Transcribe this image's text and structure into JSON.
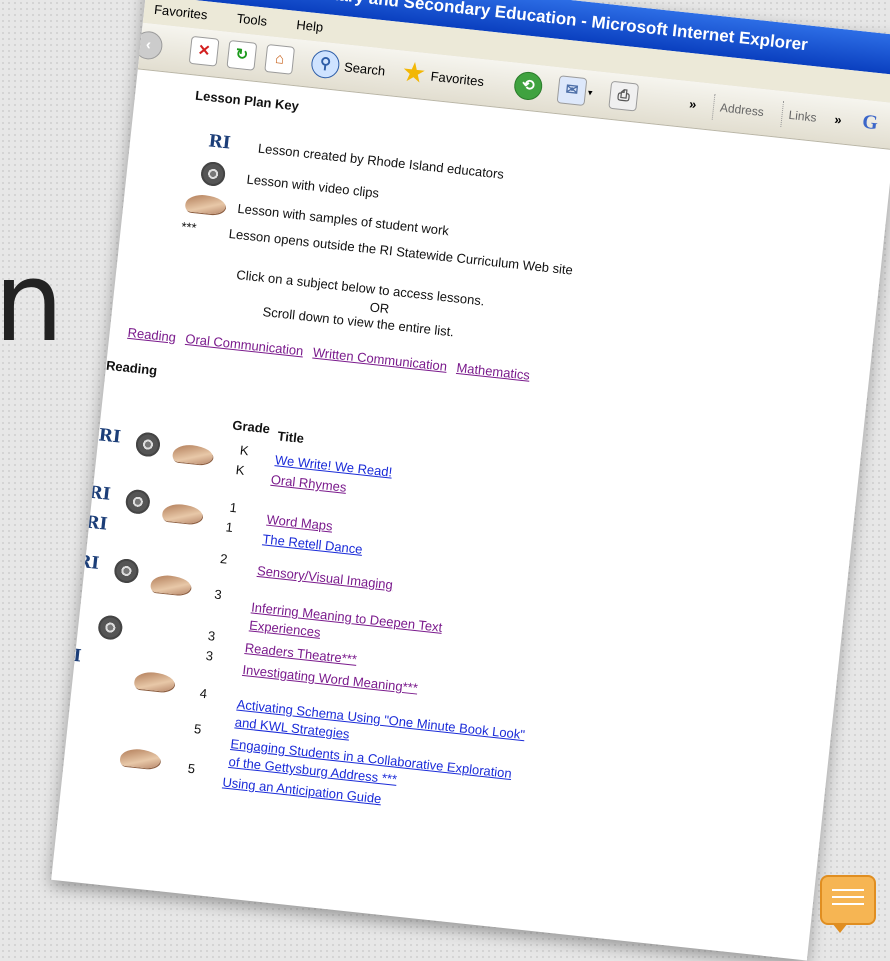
{
  "window": {
    "title": "Department of Elementary and Secondary Education - Microsoft Internet Explorer"
  },
  "menu": [
    "Favorites",
    "Tools",
    "Help"
  ],
  "toolbar": {
    "search_label": "Search",
    "favorites_label": "Favorites",
    "chevron": "»",
    "address_label": "Address",
    "links_label": "Links",
    "links_chevron": "»",
    "trailing_label": "G"
  },
  "key": {
    "heading": "Lesson Plan Key",
    "items": [
      {
        "icon": "ri-icon",
        "marker": "RI",
        "text": "Lesson created by Rhode Island educators"
      },
      {
        "icon": "film-reel-icon",
        "text": "Lesson with video clips"
      },
      {
        "icon": "hand-icon",
        "text": "Lesson with samples of student work"
      },
      {
        "icon": "asterisks",
        "marker": "***",
        "text": "Lesson opens outside the RI Statewide Curriculum Web site"
      }
    ]
  },
  "instructions": {
    "line1": "Click on a subject below to access lessons.",
    "line2": "OR",
    "line3": "Scroll down to view the entire list."
  },
  "subjects": [
    "Reading",
    "Oral Communication",
    "Written Communication",
    "Mathematics"
  ],
  "reading_section": {
    "heading": "Reading",
    "col_grade": "Grade",
    "col_title": "Title",
    "rows": [
      {
        "grade": "K",
        "title": "We Write! We Read!",
        "ri": "RI",
        "video": true,
        "work": true
      },
      {
        "grade": "K",
        "title": "Oral Rhymes"
      },
      {
        "grade": "1",
        "title": "Word Maps",
        "ri": "RI",
        "video": true,
        "work": true
      },
      {
        "grade": "1",
        "title": "The Retell Dance",
        "ri": "RI"
      },
      {
        "grade": "2",
        "title": "Sensory/Visual Imaging"
      },
      {
        "grade": "3",
        "title": "Inferring Meaning to Deepen Text Experiences",
        "ri": "RI",
        "video": true,
        "work": true
      },
      {
        "grade": "3",
        "title": "Readers Theatre***",
        "video": true
      },
      {
        "grade": "3",
        "title": "Investigating Word Meaning***"
      },
      {
        "grade": "4",
        "title": "Activating Schema Using \"One Minute Book Look\" and KWL Strategies",
        "ri": "RI",
        "work": true
      },
      {
        "grade": "5",
        "title": "Engaging Students in a Collaborative Exploration of the Gettysburg Address ***"
      },
      {
        "grade": "5",
        "title": "Using an Anticipation Guide",
        "ri": "RI",
        "work": true
      }
    ]
  },
  "background_letter": "n"
}
